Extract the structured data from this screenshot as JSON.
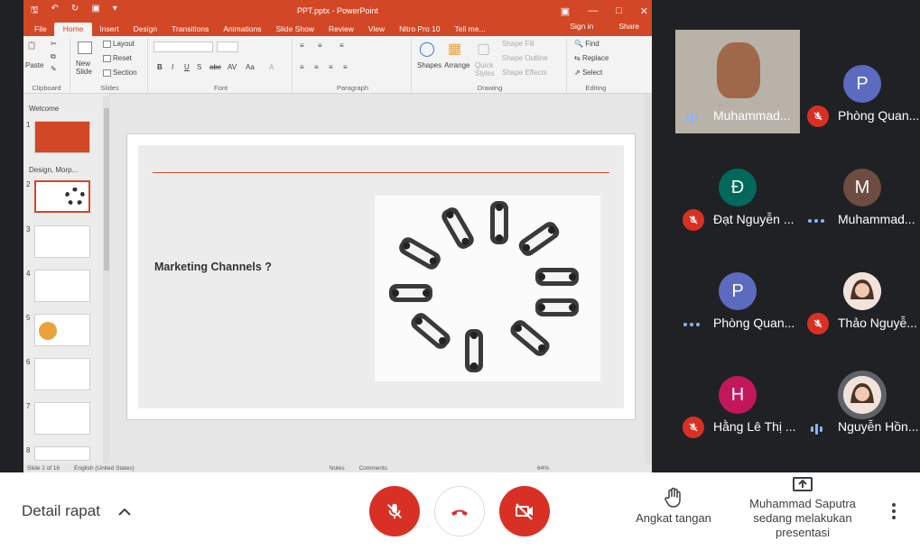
{
  "ppt": {
    "window_title": "PPT.pptx - PowerPoint",
    "tabs": [
      "File",
      "Home",
      "Insert",
      "Design",
      "Transitions",
      "Animations",
      "Slide Show",
      "Review",
      "View",
      "Nitro Pro 10",
      "Tell me..."
    ],
    "sign_in": "Sign in",
    "share": "Share",
    "ribbon": {
      "paste": "Paste",
      "clipboard": "Clipboard",
      "new_slide": "New Slide",
      "layout": "Layout",
      "reset": "Reset",
      "section": "Section",
      "slides": "Slides",
      "font": "Font",
      "paragraph": "Paragraph",
      "shapes": "Shapes",
      "arrange": "Arrange",
      "quick_styles": "Quick Styles",
      "shape_fill": "Shape Fill",
      "shape_outline": "Shape Outline",
      "shape_effects": "Shape Effects",
      "drawing": "Drawing",
      "find": "Find",
      "replace": "Replace",
      "select": "Select",
      "editing": "Editing"
    },
    "sections": {
      "welcome": "Welcome",
      "design": "Design, Morp..."
    },
    "slide_numbers": [
      "1",
      "2",
      "3",
      "4",
      "5",
      "6",
      "7",
      "8"
    ],
    "slide_title": "Marketing Channels ?",
    "status": {
      "slide": "Slide 2 of 16",
      "lang": "English (United States)",
      "notes": "Notes",
      "comments": "Comments",
      "zoom": "64%"
    }
  },
  "participants": [
    {
      "name": "Muhammad...",
      "initial": "",
      "color": "#5f6368",
      "state": "speaking",
      "photo": true
    },
    {
      "name": "Phòng Quan...",
      "initial": "P",
      "color": "#5c6bc0",
      "state": "muted"
    },
    {
      "name": "Đạt Nguyễn ...",
      "initial": "Đ",
      "color": "#00695c",
      "state": "muted"
    },
    {
      "name": "Muhammad...",
      "initial": "M",
      "color": "#6d4c41",
      "state": "dots"
    },
    {
      "name": "Phòng Quan...",
      "initial": "P",
      "color": "#5c6bc0",
      "state": "dots"
    },
    {
      "name": "Thảo Nguyễ...",
      "initial": "",
      "color": "#f1e3dc",
      "state": "muted",
      "photo": true
    },
    {
      "name": "Hằng Lê Thị ...",
      "initial": "H",
      "color": "#c2185b",
      "state": "muted"
    },
    {
      "name": "Nguyễn Hồn...",
      "initial": "",
      "color": "#f1e3dc",
      "state": "speaking",
      "photo": true
    }
  ],
  "bottom": {
    "detail": "Detail rapat",
    "raise_hand": "Angkat tangan",
    "presenting": "Muhammad Saputra sedang melakukan presentasi"
  }
}
